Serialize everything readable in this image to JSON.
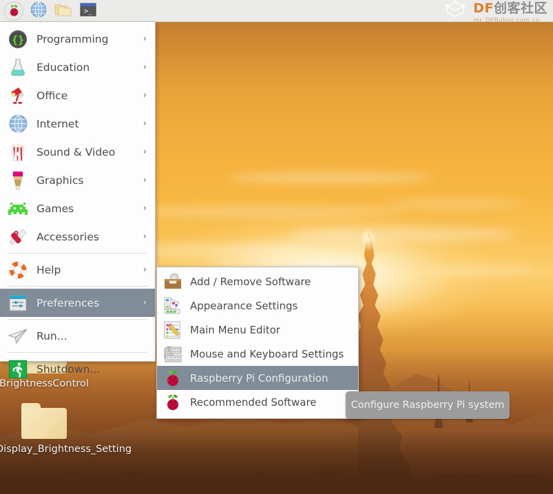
{
  "taskbar": {
    "items": [
      {
        "name": "raspberry-menu-button",
        "icon": "raspberry-icon",
        "label": "Menu"
      },
      {
        "name": "web-browser-button",
        "icon": "globe-icon",
        "label": "Web Browser"
      },
      {
        "name": "file-manager-button",
        "icon": "folder-icon",
        "label": "File Manager"
      },
      {
        "name": "terminal-button",
        "icon": "terminal-icon",
        "label": "Terminal"
      }
    ],
    "watermark": {
      "brand_latin": "DF",
      "brand_cn": "创客社区",
      "url": "mc.DFRobot.com.cn"
    }
  },
  "main_menu": {
    "items": [
      {
        "label": "Programming",
        "icon": "code-braces-icon",
        "arrow": "›",
        "selected": false,
        "separator_after": false
      },
      {
        "label": "Education",
        "icon": "flask-icon",
        "arrow": "›",
        "selected": false,
        "separator_after": false
      },
      {
        "label": "Office",
        "icon": "desk-lamp-icon",
        "arrow": "›",
        "selected": false,
        "separator_after": false
      },
      {
        "label": "Internet",
        "icon": "globe-icon",
        "arrow": "›",
        "selected": false,
        "separator_after": false
      },
      {
        "label": "Sound & Video",
        "icon": "popcorn-video-icon",
        "arrow": "›",
        "selected": false,
        "separator_after": false
      },
      {
        "label": "Graphics",
        "icon": "paintbrush-icon",
        "arrow": "›",
        "selected": false,
        "separator_after": false
      },
      {
        "label": "Games",
        "icon": "space-invader-icon",
        "arrow": "›",
        "selected": false,
        "separator_after": false
      },
      {
        "label": "Accessories",
        "icon": "swiss-army-knife-icon",
        "arrow": "›",
        "selected": false,
        "separator_after": true
      },
      {
        "label": "Help",
        "icon": "life-ring-icon",
        "arrow": "›",
        "selected": false,
        "separator_after": true
      },
      {
        "label": "Preferences",
        "icon": "settings-window-icon",
        "arrow": "›",
        "selected": true,
        "separator_after": true
      },
      {
        "label": "Run...",
        "icon": "paper-plane-icon",
        "arrow": "",
        "selected": false,
        "separator_after": true
      },
      {
        "label": "Shutdown...",
        "icon": "exit-running-man-icon",
        "arrow": "",
        "selected": false,
        "separator_after": false
      }
    ]
  },
  "submenu": {
    "parent": "Preferences",
    "items": [
      {
        "label": "Add / Remove Software",
        "icon": "software-briefcase-icon",
        "selected": false
      },
      {
        "label": "Appearance Settings",
        "icon": "color-palette-icon",
        "selected": false
      },
      {
        "label": "Main Menu Editor",
        "icon": "list-pencil-icon",
        "selected": false
      },
      {
        "label": "Mouse and Keyboard Settings",
        "icon": "mouse-keyboard-icon",
        "selected": false
      },
      {
        "label": "Raspberry Pi Configuration",
        "icon": "raspberry-icon",
        "selected": true
      },
      {
        "label": "Recommended Software",
        "icon": "raspberry-icon",
        "selected": false
      }
    ]
  },
  "tooltip": {
    "text": "Configure Raspberry Pi system"
  },
  "desktop": {
    "icons": [
      {
        "label": "BrightnessControl",
        "icon": "folder-icon"
      },
      {
        "label": "Display_Brightness_Setting",
        "icon": "folder-icon"
      }
    ]
  },
  "colors": {
    "highlight": "#808d99",
    "menu_background": "#fdfdfd",
    "taskbar_background": "#ebebe9",
    "tooltip_background": "#9c9c9c",
    "brand_orange": "#d9822b",
    "raspberry_red": "#c9173f",
    "raspberry_green": "#74bf3d"
  }
}
